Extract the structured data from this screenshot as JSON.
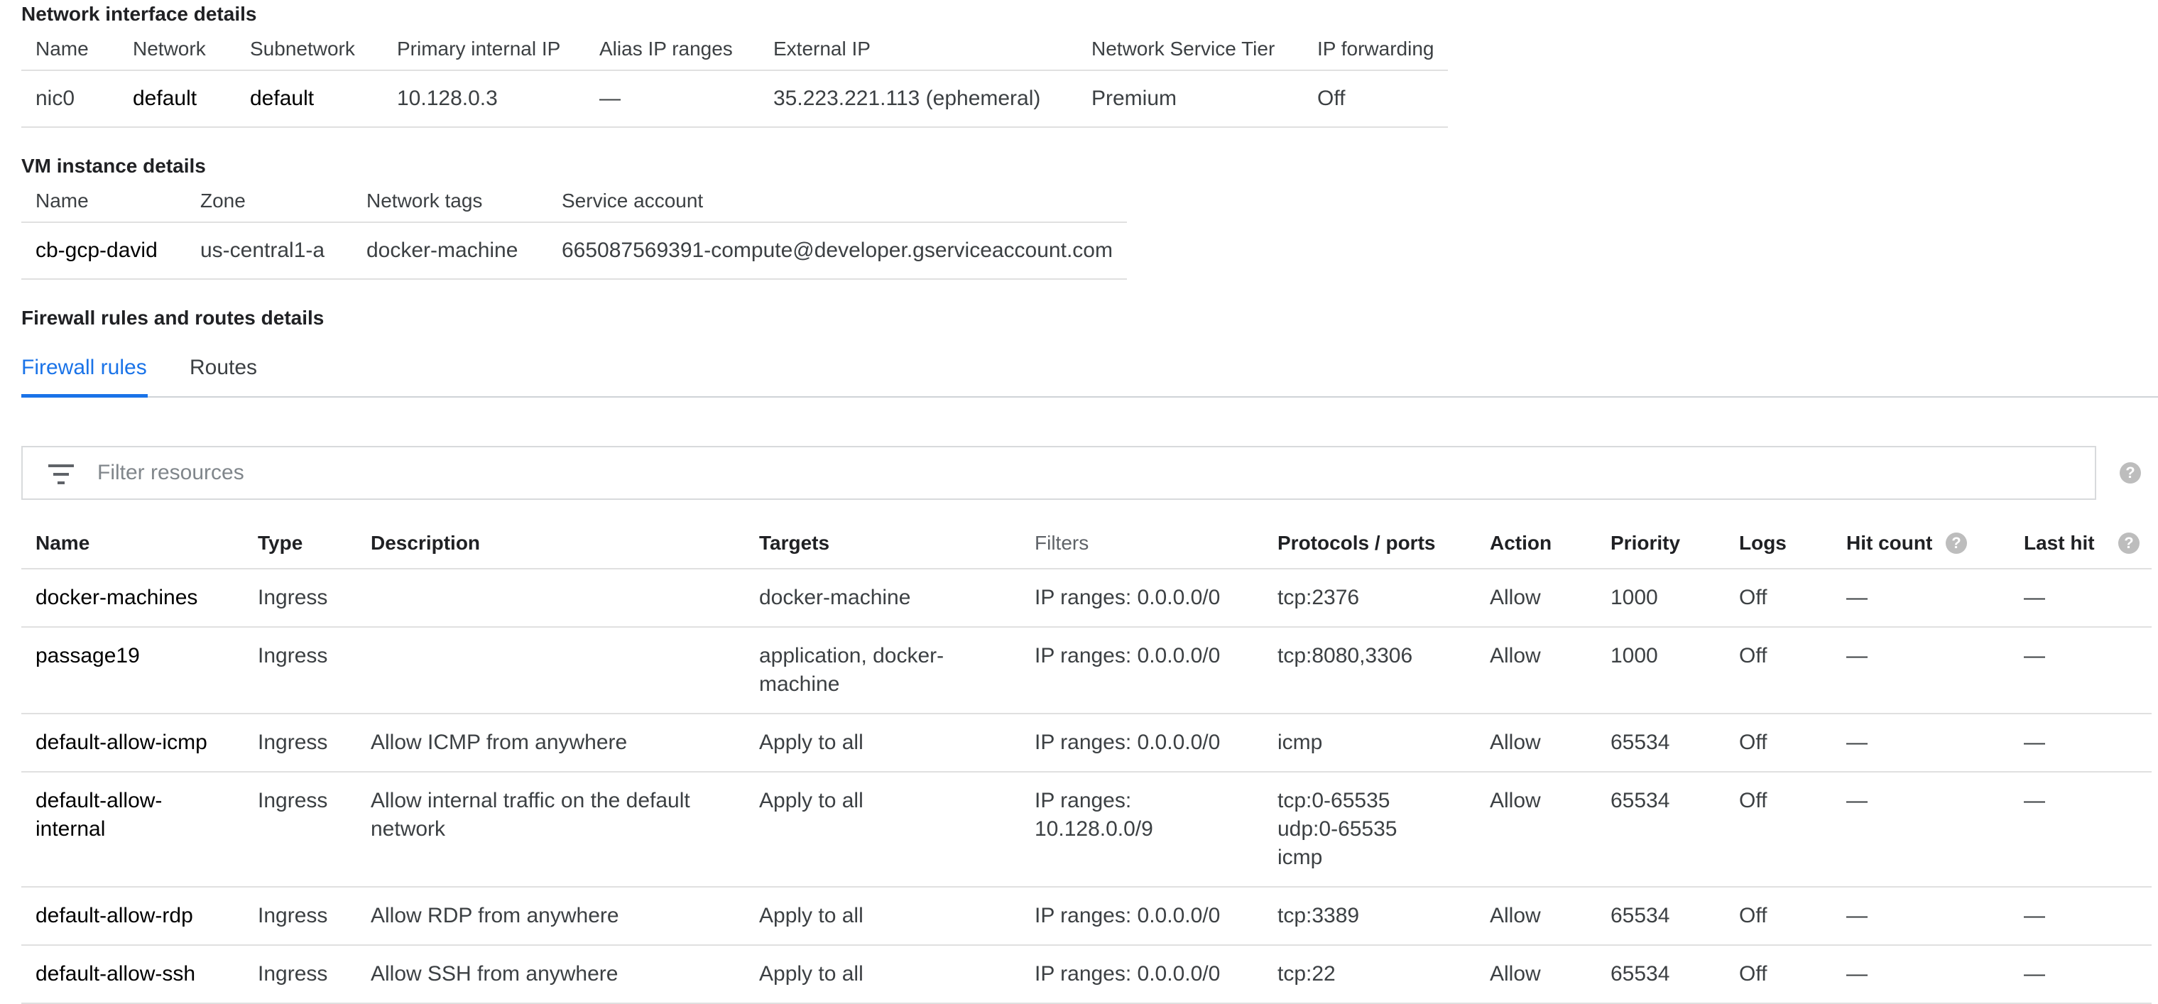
{
  "network_interface": {
    "title": "Network interface details",
    "columns": [
      "Name",
      "Network",
      "Subnetwork",
      "Primary internal IP",
      "Alias IP ranges",
      "External IP",
      "Network Service Tier",
      "IP forwarding"
    ],
    "row": [
      "nic0",
      "default",
      "default",
      "10.128.0.3",
      "—",
      "35.223.221.113 (ephemeral)",
      "Premium",
      "Off"
    ]
  },
  "vm_instance": {
    "title": "VM instance details",
    "columns": [
      "Name",
      "Zone",
      "Network tags",
      "Service account"
    ],
    "row": [
      "cb-gcp-david",
      "us-central1-a",
      "docker-machine",
      "665087569391-compute@developer.gserviceaccount.com"
    ]
  },
  "firewall_section": {
    "title": "Firewall rules and routes details",
    "tabs": [
      {
        "label": "Firewall rules",
        "active": true
      },
      {
        "label": "Routes",
        "active": false
      }
    ],
    "filter_placeholder": "Filter resources",
    "filter_icon": "filter-list-icon",
    "help_icon": "help-icon",
    "columns": [
      "Name",
      "Type",
      "Description",
      "Targets",
      "Filters",
      "Protocols / ports",
      "Action",
      "Priority",
      "Logs",
      "Hit count",
      "Last hit"
    ],
    "rows": [
      {
        "name": "docker-machines",
        "type": "Ingress",
        "description": "",
        "targets": "docker-machine",
        "filters": "IP ranges: 0.0.0.0/0",
        "protocols": [
          "tcp:2376"
        ],
        "action": "Allow",
        "priority": "1000",
        "logs": "Off",
        "hit_count": "—",
        "last_hit": "—"
      },
      {
        "name": "passage19",
        "type": "Ingress",
        "description": "",
        "targets": "application, docker-machine",
        "filters": "IP ranges: 0.0.0.0/0",
        "protocols": [
          "tcp:8080,3306"
        ],
        "action": "Allow",
        "priority": "1000",
        "logs": "Off",
        "hit_count": "—",
        "last_hit": "—"
      },
      {
        "name": "default-allow-icmp",
        "type": "Ingress",
        "description": "Allow ICMP from anywhere",
        "targets": "Apply to all",
        "filters": "IP ranges: 0.0.0.0/0",
        "protocols": [
          "icmp"
        ],
        "action": "Allow",
        "priority": "65534",
        "logs": "Off",
        "hit_count": "—",
        "last_hit": "—"
      },
      {
        "name": "default-allow-internal",
        "type": "Ingress",
        "description": "Allow internal traffic on the default network",
        "targets": "Apply to all",
        "filters": "IP ranges: 10.128.0.0/9",
        "protocols": [
          "tcp:0-65535",
          "udp:0-65535",
          "icmp"
        ],
        "action": "Allow",
        "priority": "65534",
        "logs": "Off",
        "hit_count": "—",
        "last_hit": "—"
      },
      {
        "name": "default-allow-rdp",
        "type": "Ingress",
        "description": "Allow RDP from anywhere",
        "targets": "Apply to all",
        "filters": "IP ranges: 0.0.0.0/0",
        "protocols": [
          "tcp:3389"
        ],
        "action": "Allow",
        "priority": "65534",
        "logs": "Off",
        "hit_count": "—",
        "last_hit": "—"
      },
      {
        "name": "default-allow-ssh",
        "type": "Ingress",
        "description": "Allow SSH from anywhere",
        "targets": "Apply to all",
        "filters": "IP ranges: 0.0.0.0/0",
        "protocols": [
          "tcp:22"
        ],
        "action": "Allow",
        "priority": "65534",
        "logs": "Off",
        "hit_count": "—",
        "last_hit": "—"
      }
    ]
  },
  "colors": {
    "accent": "#1a73e8",
    "text": "#202124",
    "muted": "#5f6368",
    "divider": "#e0e0e0"
  }
}
